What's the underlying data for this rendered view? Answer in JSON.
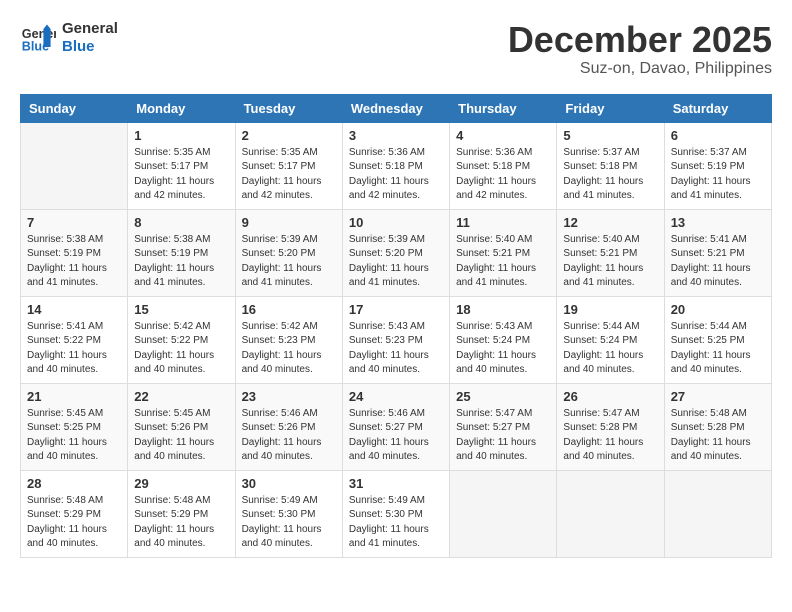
{
  "header": {
    "logo_line1": "General",
    "logo_line2": "Blue",
    "month": "December 2025",
    "location": "Suz-on, Davao, Philippines"
  },
  "weekdays": [
    "Sunday",
    "Monday",
    "Tuesday",
    "Wednesday",
    "Thursday",
    "Friday",
    "Saturday"
  ],
  "weeks": [
    [
      {
        "day": "",
        "sunrise": "",
        "sunset": "",
        "daylight": ""
      },
      {
        "day": "1",
        "sunrise": "Sunrise: 5:35 AM",
        "sunset": "Sunset: 5:17 PM",
        "daylight": "Daylight: 11 hours and 42 minutes."
      },
      {
        "day": "2",
        "sunrise": "Sunrise: 5:35 AM",
        "sunset": "Sunset: 5:17 PM",
        "daylight": "Daylight: 11 hours and 42 minutes."
      },
      {
        "day": "3",
        "sunrise": "Sunrise: 5:36 AM",
        "sunset": "Sunset: 5:18 PM",
        "daylight": "Daylight: 11 hours and 42 minutes."
      },
      {
        "day": "4",
        "sunrise": "Sunrise: 5:36 AM",
        "sunset": "Sunset: 5:18 PM",
        "daylight": "Daylight: 11 hours and 42 minutes."
      },
      {
        "day": "5",
        "sunrise": "Sunrise: 5:37 AM",
        "sunset": "Sunset: 5:18 PM",
        "daylight": "Daylight: 11 hours and 41 minutes."
      },
      {
        "day": "6",
        "sunrise": "Sunrise: 5:37 AM",
        "sunset": "Sunset: 5:19 PM",
        "daylight": "Daylight: 11 hours and 41 minutes."
      }
    ],
    [
      {
        "day": "7",
        "sunrise": "Sunrise: 5:38 AM",
        "sunset": "Sunset: 5:19 PM",
        "daylight": "Daylight: 11 hours and 41 minutes."
      },
      {
        "day": "8",
        "sunrise": "Sunrise: 5:38 AM",
        "sunset": "Sunset: 5:19 PM",
        "daylight": "Daylight: 11 hours and 41 minutes."
      },
      {
        "day": "9",
        "sunrise": "Sunrise: 5:39 AM",
        "sunset": "Sunset: 5:20 PM",
        "daylight": "Daylight: 11 hours and 41 minutes."
      },
      {
        "day": "10",
        "sunrise": "Sunrise: 5:39 AM",
        "sunset": "Sunset: 5:20 PM",
        "daylight": "Daylight: 11 hours and 41 minutes."
      },
      {
        "day": "11",
        "sunrise": "Sunrise: 5:40 AM",
        "sunset": "Sunset: 5:21 PM",
        "daylight": "Daylight: 11 hours and 41 minutes."
      },
      {
        "day": "12",
        "sunrise": "Sunrise: 5:40 AM",
        "sunset": "Sunset: 5:21 PM",
        "daylight": "Daylight: 11 hours and 41 minutes."
      },
      {
        "day": "13",
        "sunrise": "Sunrise: 5:41 AM",
        "sunset": "Sunset: 5:21 PM",
        "daylight": "Daylight: 11 hours and 40 minutes."
      }
    ],
    [
      {
        "day": "14",
        "sunrise": "Sunrise: 5:41 AM",
        "sunset": "Sunset: 5:22 PM",
        "daylight": "Daylight: 11 hours and 40 minutes."
      },
      {
        "day": "15",
        "sunrise": "Sunrise: 5:42 AM",
        "sunset": "Sunset: 5:22 PM",
        "daylight": "Daylight: 11 hours and 40 minutes."
      },
      {
        "day": "16",
        "sunrise": "Sunrise: 5:42 AM",
        "sunset": "Sunset: 5:23 PM",
        "daylight": "Daylight: 11 hours and 40 minutes."
      },
      {
        "day": "17",
        "sunrise": "Sunrise: 5:43 AM",
        "sunset": "Sunset: 5:23 PM",
        "daylight": "Daylight: 11 hours and 40 minutes."
      },
      {
        "day": "18",
        "sunrise": "Sunrise: 5:43 AM",
        "sunset": "Sunset: 5:24 PM",
        "daylight": "Daylight: 11 hours and 40 minutes."
      },
      {
        "day": "19",
        "sunrise": "Sunrise: 5:44 AM",
        "sunset": "Sunset: 5:24 PM",
        "daylight": "Daylight: 11 hours and 40 minutes."
      },
      {
        "day": "20",
        "sunrise": "Sunrise: 5:44 AM",
        "sunset": "Sunset: 5:25 PM",
        "daylight": "Daylight: 11 hours and 40 minutes."
      }
    ],
    [
      {
        "day": "21",
        "sunrise": "Sunrise: 5:45 AM",
        "sunset": "Sunset: 5:25 PM",
        "daylight": "Daylight: 11 hours and 40 minutes."
      },
      {
        "day": "22",
        "sunrise": "Sunrise: 5:45 AM",
        "sunset": "Sunset: 5:26 PM",
        "daylight": "Daylight: 11 hours and 40 minutes."
      },
      {
        "day": "23",
        "sunrise": "Sunrise: 5:46 AM",
        "sunset": "Sunset: 5:26 PM",
        "daylight": "Daylight: 11 hours and 40 minutes."
      },
      {
        "day": "24",
        "sunrise": "Sunrise: 5:46 AM",
        "sunset": "Sunset: 5:27 PM",
        "daylight": "Daylight: 11 hours and 40 minutes."
      },
      {
        "day": "25",
        "sunrise": "Sunrise: 5:47 AM",
        "sunset": "Sunset: 5:27 PM",
        "daylight": "Daylight: 11 hours and 40 minutes."
      },
      {
        "day": "26",
        "sunrise": "Sunrise: 5:47 AM",
        "sunset": "Sunset: 5:28 PM",
        "daylight": "Daylight: 11 hours and 40 minutes."
      },
      {
        "day": "27",
        "sunrise": "Sunrise: 5:48 AM",
        "sunset": "Sunset: 5:28 PM",
        "daylight": "Daylight: 11 hours and 40 minutes."
      }
    ],
    [
      {
        "day": "28",
        "sunrise": "Sunrise: 5:48 AM",
        "sunset": "Sunset: 5:29 PM",
        "daylight": "Daylight: 11 hours and 40 minutes."
      },
      {
        "day": "29",
        "sunrise": "Sunrise: 5:48 AM",
        "sunset": "Sunset: 5:29 PM",
        "daylight": "Daylight: 11 hours and 40 minutes."
      },
      {
        "day": "30",
        "sunrise": "Sunrise: 5:49 AM",
        "sunset": "Sunset: 5:30 PM",
        "daylight": "Daylight: 11 hours and 40 minutes."
      },
      {
        "day": "31",
        "sunrise": "Sunrise: 5:49 AM",
        "sunset": "Sunset: 5:30 PM",
        "daylight": "Daylight: 11 hours and 41 minutes."
      },
      {
        "day": "",
        "sunrise": "",
        "sunset": "",
        "daylight": ""
      },
      {
        "day": "",
        "sunrise": "",
        "sunset": "",
        "daylight": ""
      },
      {
        "day": "",
        "sunrise": "",
        "sunset": "",
        "daylight": ""
      }
    ]
  ]
}
